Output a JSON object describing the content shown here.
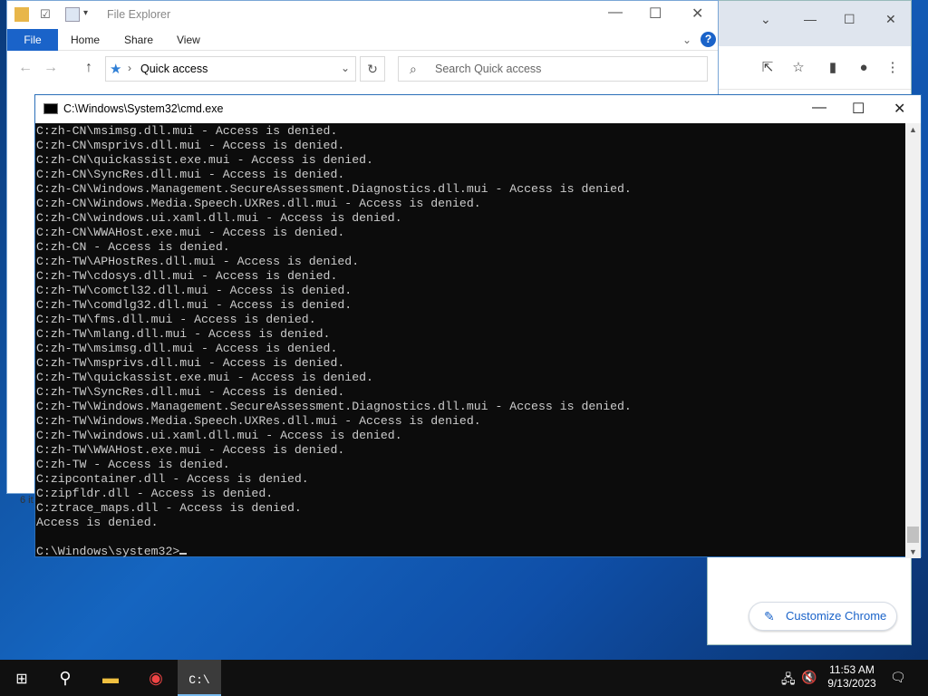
{
  "file_explorer": {
    "title": "File Explorer",
    "tabs": [
      "File",
      "Home",
      "Share",
      "View"
    ],
    "address": "Quick access",
    "search_placeholder": "Search Quick access",
    "status": "6 it"
  },
  "chrome": {
    "customize_label": "Customize Chrome"
  },
  "cmd": {
    "title": "C:\\Windows\\System32\\cmd.exe",
    "lines": [
      "C:zh-CN\\msimsg.dll.mui - Access is denied.",
      "C:zh-CN\\msprivs.dll.mui - Access is denied.",
      "C:zh-CN\\quickassist.exe.mui - Access is denied.",
      "C:zh-CN\\SyncRes.dll.mui - Access is denied.",
      "C:zh-CN\\Windows.Management.SecureAssessment.Diagnostics.dll.mui - Access is denied.",
      "C:zh-CN\\Windows.Media.Speech.UXRes.dll.mui - Access is denied.",
      "C:zh-CN\\windows.ui.xaml.dll.mui - Access is denied.",
      "C:zh-CN\\WWAHost.exe.mui - Access is denied.",
      "C:zh-CN - Access is denied.",
      "C:zh-TW\\APHostRes.dll.mui - Access is denied.",
      "C:zh-TW\\cdosys.dll.mui - Access is denied.",
      "C:zh-TW\\comctl32.dll.mui - Access is denied.",
      "C:zh-TW\\comdlg32.dll.mui - Access is denied.",
      "C:zh-TW\\fms.dll.mui - Access is denied.",
      "C:zh-TW\\mlang.dll.mui - Access is denied.",
      "C:zh-TW\\msimsg.dll.mui - Access is denied.",
      "C:zh-TW\\msprivs.dll.mui - Access is denied.",
      "C:zh-TW\\quickassist.exe.mui - Access is denied.",
      "C:zh-TW\\SyncRes.dll.mui - Access is denied.",
      "C:zh-TW\\Windows.Management.SecureAssessment.Diagnostics.dll.mui - Access is denied.",
      "C:zh-TW\\Windows.Media.Speech.UXRes.dll.mui - Access is denied.",
      "C:zh-TW\\windows.ui.xaml.dll.mui - Access is denied.",
      "C:zh-TW\\WWAHost.exe.mui - Access is denied.",
      "C:zh-TW - Access is denied.",
      "C:zipcontainer.dll - Access is denied.",
      "C:zipfldr.dll - Access is denied.",
      "C:ztrace_maps.dll - Access is denied.",
      "Access is denied.",
      "",
      "C:\\Windows\\system32>"
    ]
  },
  "taskbar": {
    "time": "11:53 AM",
    "date": "9/13/2023"
  }
}
